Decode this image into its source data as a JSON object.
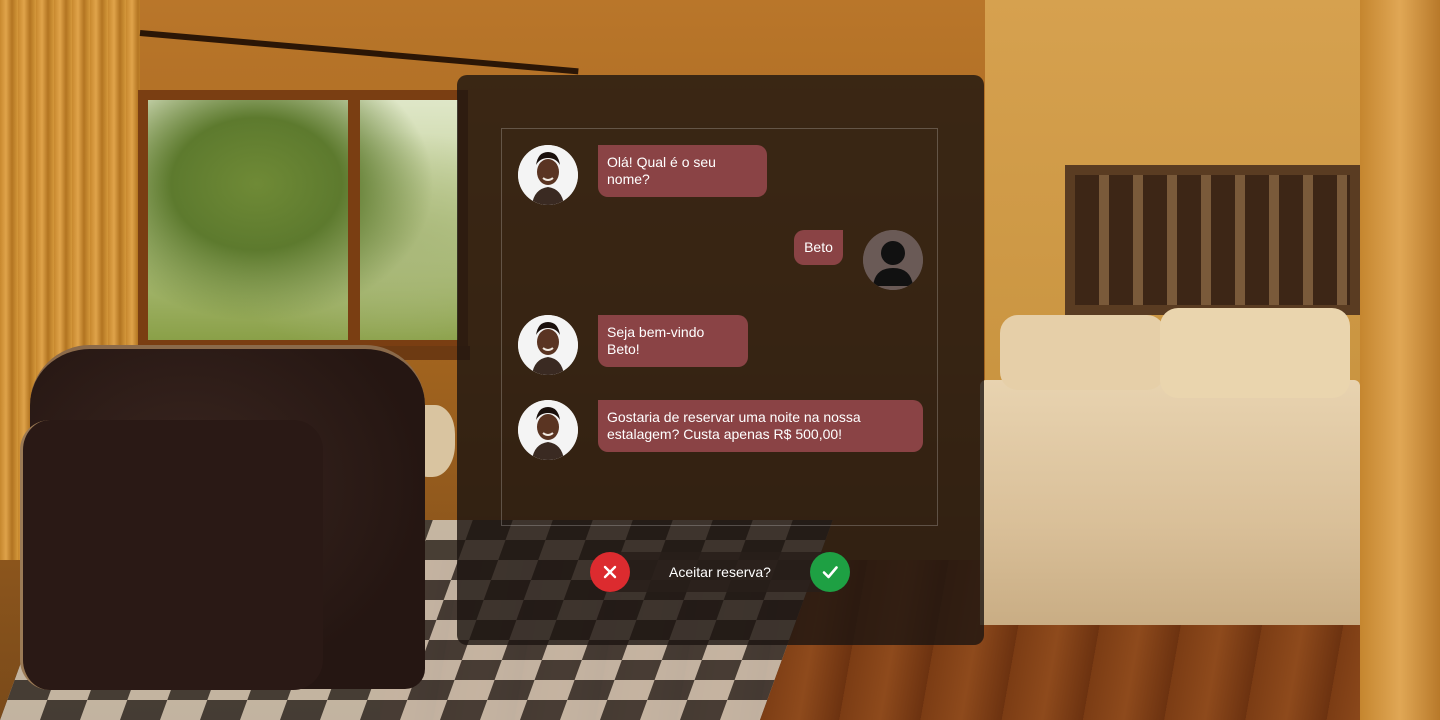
{
  "chat": {
    "messages": [
      {
        "sender": "bot",
        "text": "Olá! Qual é o seu nome?"
      },
      {
        "sender": "user",
        "text": "Beto"
      },
      {
        "sender": "bot",
        "text": "Seja bem-vindo Beto!"
      },
      {
        "sender": "bot",
        "text": "Gostaria de reservar uma noite na nossa estalagem? Custa apenas R$ 500,00!"
      }
    ]
  },
  "reservation": {
    "prompt": "Aceitar reserva?",
    "decline_icon": "close-icon",
    "accept_icon": "check-icon"
  },
  "colors": {
    "bubble": "#8a4345",
    "decline": "#dc2b2f",
    "accept": "#1ea043",
    "panel": "#1c1410"
  }
}
